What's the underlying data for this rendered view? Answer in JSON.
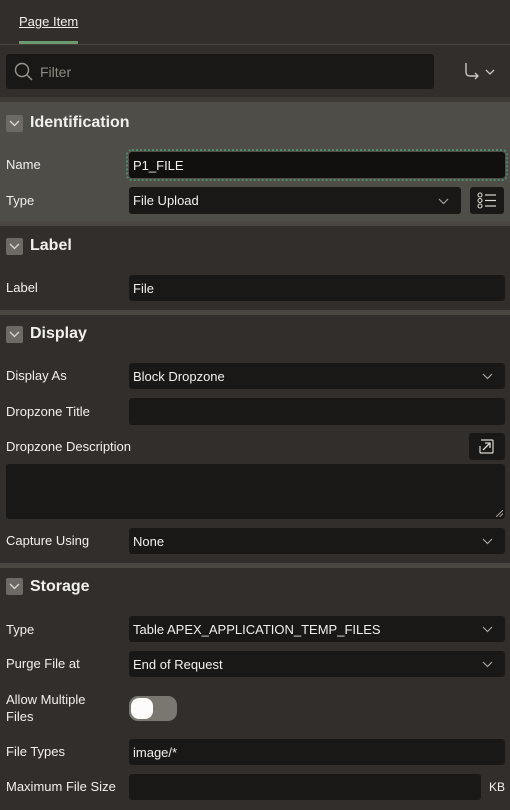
{
  "tabs": [
    {
      "label": "Page Item",
      "active": true
    }
  ],
  "filter": {
    "placeholder": "Filter",
    "value": ""
  },
  "toolbar": {
    "goto_icon": "go-to-group-icon"
  },
  "sections": {
    "identification": {
      "title": "Identification",
      "name_label": "Name",
      "name_value": "P1_FILE",
      "type_label": "Type",
      "type_value": "File Upload"
    },
    "label": {
      "title": "Label",
      "label_label": "Label",
      "label_value": "File"
    },
    "display": {
      "title": "Display",
      "display_as_label": "Display As",
      "display_as_value": "Block Dropzone",
      "dropzone_title_label": "Dropzone Title",
      "dropzone_title_value": "",
      "dropzone_description_label": "Dropzone Description",
      "dropzone_description_value": "",
      "capture_using_label": "Capture Using",
      "capture_using_value": "None"
    },
    "storage": {
      "title": "Storage",
      "type_label": "Type",
      "type_value": "Table APEX_APPLICATION_TEMP_FILES",
      "purge_label": "Purge File at",
      "purge_value": "End of Request",
      "allow_multiple_label_line1": "Allow Multiple",
      "allow_multiple_label_line2": "Files",
      "allow_multiple_value": false,
      "file_types_label": "File Types",
      "file_types_value": "image/*",
      "max_size_label": "Maximum File Size",
      "max_size_value": "",
      "max_size_unit": "KB"
    }
  },
  "colors": {
    "accent_tab": "#6b9a6e",
    "focus_outline": "#4d8a6a",
    "panel_bg": "#322e2b",
    "active_section_bg": "#4f4d48",
    "field_bg": "#1a1816"
  }
}
